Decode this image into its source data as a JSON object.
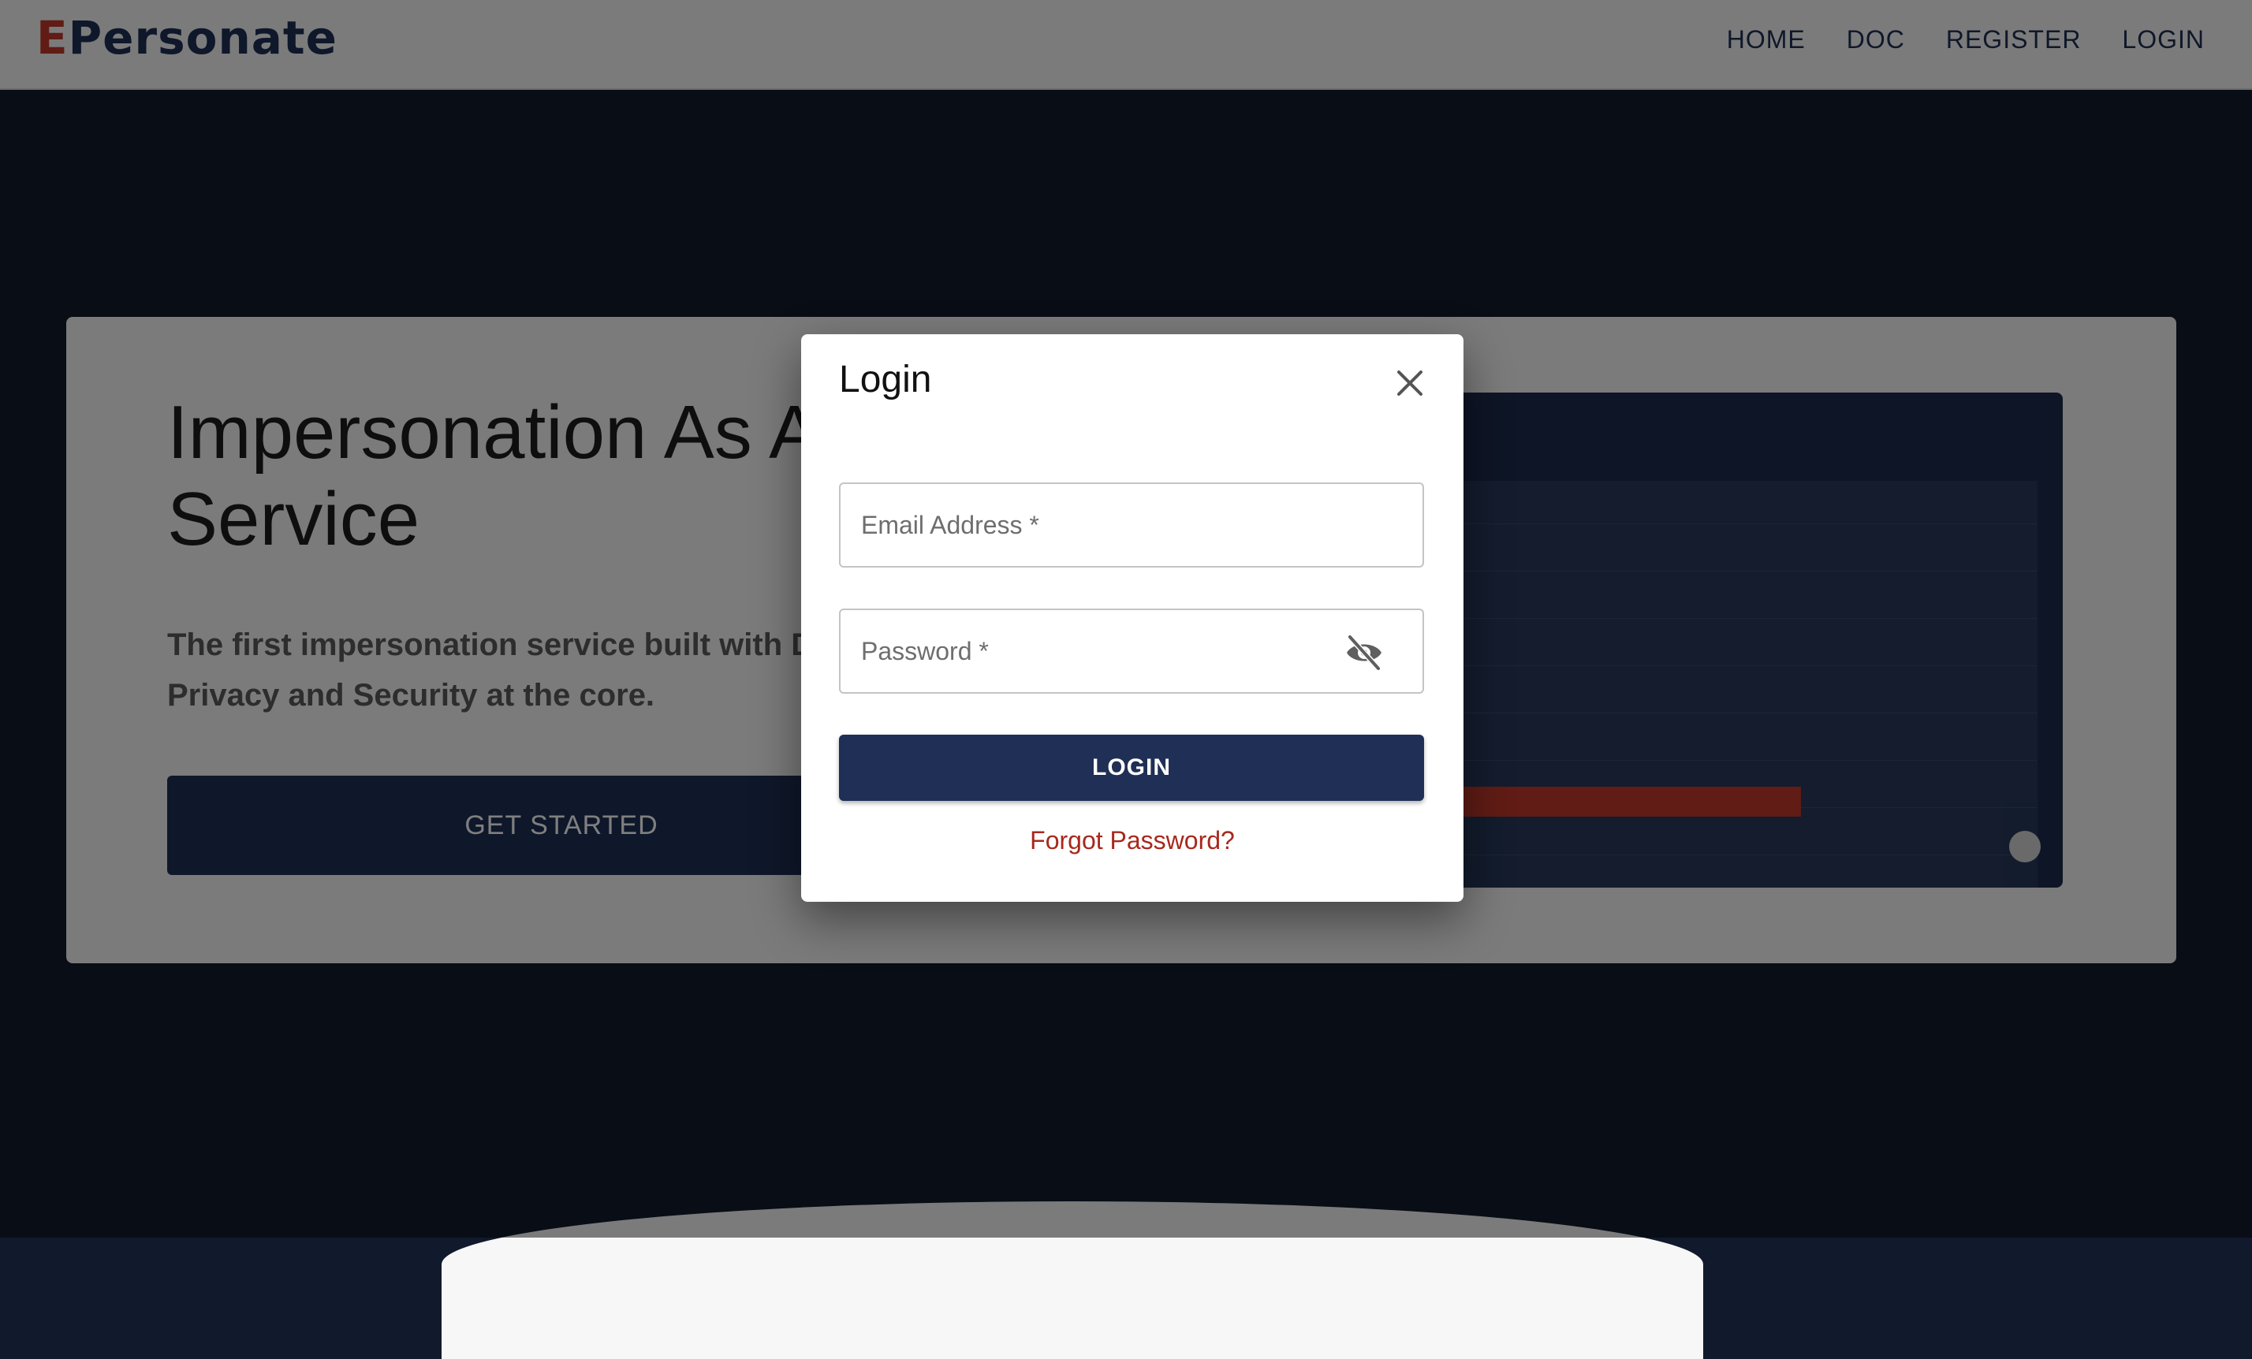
{
  "header": {
    "logo_first_letter": "E",
    "logo_rest": "Personate",
    "nav": [
      "HOME",
      "DOC",
      "REGISTER",
      "LOGIN"
    ]
  },
  "hero": {
    "title_line1": "Impersonation As A",
    "title_line2": "Service",
    "description": "The first impersonation service built with Data Privacy and Security at the core.",
    "cta_label": "GET STARTED"
  },
  "login_dialog": {
    "title": "Login",
    "email_placeholder": "Email Address *",
    "password_placeholder": "Password *",
    "submit_label": "LOGIN",
    "forgot_label": "Forgot Password?"
  },
  "colors": {
    "brand_navy": "#1f2f55",
    "brand_red": "#c0392b",
    "page_background": "#111a2c"
  },
  "icons": {
    "close": "close-icon",
    "visibility_off": "visibility-off-icon"
  }
}
